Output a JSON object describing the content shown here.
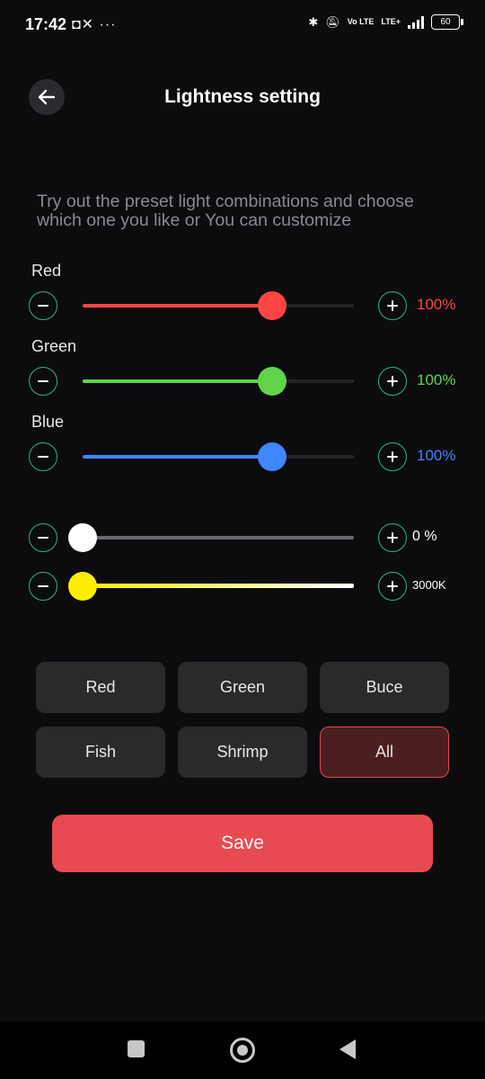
{
  "status": {
    "time": "17:42",
    "left_icons": "◘✕ ···",
    "lte_top": "LTE+",
    "volte": "Vo LTE",
    "battery": "60"
  },
  "header": {
    "title": "Lightness setting"
  },
  "description": "Try out the preset light combinations and choose which one you like or You can customize",
  "channels": [
    {
      "label": "Red",
      "value": "100%",
      "level": 0.7,
      "color": "#ff4444"
    },
    {
      "label": "Green",
      "value": "100%",
      "level": 0.7,
      "color": "#5fd34a"
    },
    {
      "label": "Blue",
      "value": "100%",
      "level": 0.7,
      "color": "#3f86ff"
    }
  ],
  "brightness": {
    "value": "0 %",
    "level": 0.0
  },
  "temperature": {
    "value": "3000K",
    "level": 0.0
  },
  "presets": [
    {
      "label": "Red",
      "active": false
    },
    {
      "label": "Green",
      "active": false
    },
    {
      "label": "Buce",
      "active": false
    },
    {
      "label": "Fish",
      "active": false
    },
    {
      "label": "Shrimp",
      "active": false
    },
    {
      "label": "All",
      "active": true
    }
  ],
  "save_label": "Save",
  "colors": {
    "accent": "#e84a52",
    "button_border": "#2fb48a"
  }
}
